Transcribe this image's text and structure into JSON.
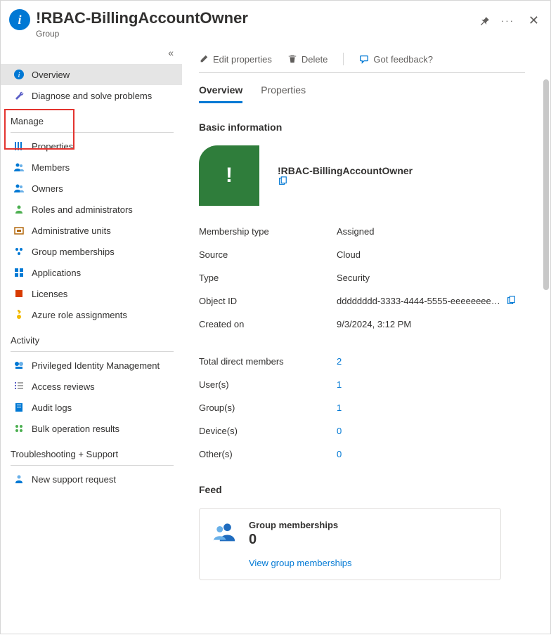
{
  "header": {
    "title": "!RBAC-BillingAccountOwner",
    "subtitle": "Group"
  },
  "sidebar": {
    "top": [
      {
        "icon": "info",
        "label": "Overview",
        "active": true
      },
      {
        "icon": "wrench",
        "label": "Diagnose and solve problems"
      }
    ],
    "sections": [
      {
        "title": "Manage",
        "items": [
          {
            "icon": "props",
            "label": "Properties"
          },
          {
            "icon": "members",
            "label": "Members"
          },
          {
            "icon": "members",
            "label": "Owners"
          },
          {
            "icon": "role",
            "label": "Roles and administrators"
          },
          {
            "icon": "admin",
            "label": "Administrative units"
          },
          {
            "icon": "gmember",
            "label": "Group memberships"
          },
          {
            "icon": "apps",
            "label": "Applications"
          },
          {
            "icon": "license",
            "label": "Licenses"
          },
          {
            "icon": "key",
            "label": "Azure role assignments"
          }
        ]
      },
      {
        "title": "Activity",
        "items": [
          {
            "icon": "pim",
            "label": "Privileged Identity Management"
          },
          {
            "icon": "checklist",
            "label": "Access reviews"
          },
          {
            "icon": "audit",
            "label": "Audit logs"
          },
          {
            "icon": "bulk",
            "label": "Bulk operation results"
          }
        ]
      },
      {
        "title": "Troubleshooting + Support",
        "items": [
          {
            "icon": "support",
            "label": "New support request"
          }
        ]
      }
    ]
  },
  "toolbar": {
    "edit": "Edit properties",
    "delete": "Delete",
    "feedback": "Got feedback?"
  },
  "tabs": [
    "Overview",
    "Properties"
  ],
  "basic_info": {
    "section": "Basic information",
    "name": "!RBAC-BillingAccountOwner",
    "rows": [
      {
        "label": "Membership type",
        "value": "Assigned"
      },
      {
        "label": "Source",
        "value": "Cloud"
      },
      {
        "label": "Type",
        "value": "Security"
      },
      {
        "label": "Object ID",
        "value": "dddddddd-3333-4444-5555-eeeeeeee…",
        "copy": true
      },
      {
        "label": "Created on",
        "value": "9/3/2024, 3:12 PM"
      }
    ]
  },
  "members": {
    "rows": [
      {
        "label": "Total direct members",
        "value": "2",
        "link": true
      },
      {
        "label": "User(s)",
        "value": "1",
        "link": true
      },
      {
        "label": "Group(s)",
        "value": "1",
        "link": true
      },
      {
        "label": "Device(s)",
        "value": "0",
        "link": true
      },
      {
        "label": "Other(s)",
        "value": "0",
        "link": true
      }
    ]
  },
  "feed": {
    "title": "Feed",
    "card": {
      "title": "Group memberships",
      "count": "0",
      "link": "View group memberships"
    }
  }
}
